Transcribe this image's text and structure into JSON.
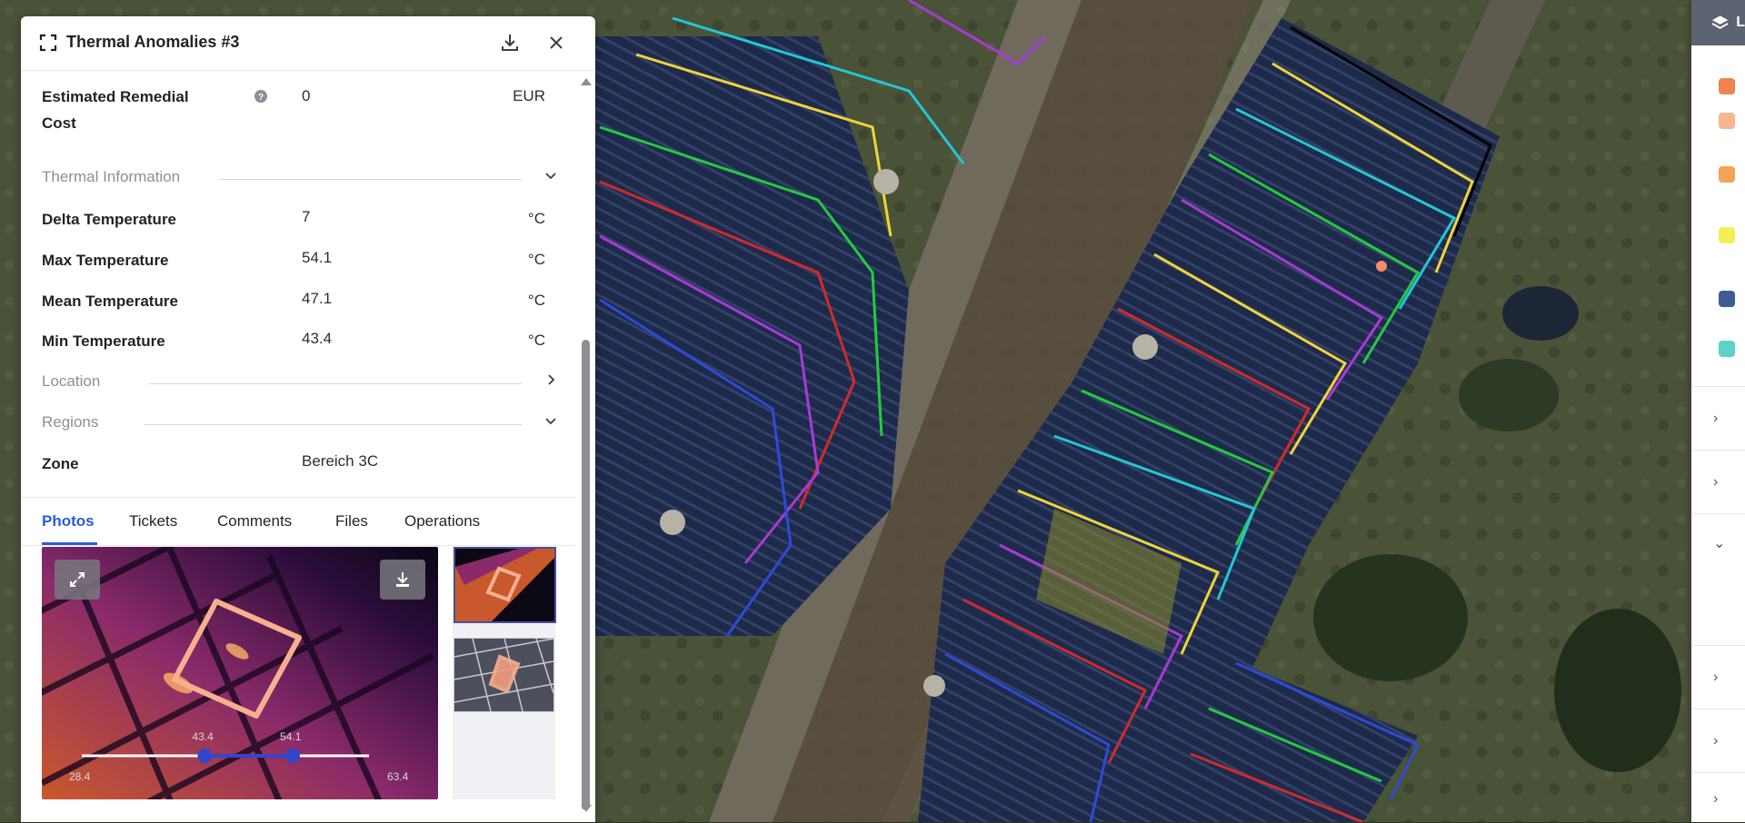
{
  "panel": {
    "title": "Thermal Anomalies #3",
    "fields": {
      "remedial_cost_label": "Estimated Remedial",
      "remedial_cost_label_2": "Cost",
      "remedial_cost_value": "0",
      "remedial_cost_unit": "EUR"
    },
    "sections": {
      "thermal": "Thermal Information",
      "location": "Location",
      "regions": "Regions"
    },
    "thermal_rows": [
      {
        "label": "Delta Temperature",
        "value": "7",
        "unit": "°C"
      },
      {
        "label": "Max Temperature",
        "value": "54.1",
        "unit": "°C"
      },
      {
        "label": "Mean Temperature",
        "value": "47.1",
        "unit": "°C"
      },
      {
        "label": "Min Temperature",
        "value": "43.4",
        "unit": "°C"
      }
    ],
    "zone": {
      "label": "Zone",
      "value": "Bereich 3C"
    },
    "tabs": [
      "Photos",
      "Tickets",
      "Comments",
      "Files",
      "Operations"
    ],
    "active_tab": "Photos",
    "photo_slider": {
      "min": "28.4",
      "max": "63.4",
      "low": "43.4",
      "high": "54.1",
      "low_value": 43.4,
      "high_value": 54.1,
      "range_min": 28.4,
      "range_max": 63.4
    }
  },
  "layers_panel": {
    "header_label": "L",
    "swatch_colors": [
      "#f0834f",
      "#f7b591",
      "#f2a455",
      "#f3ee55",
      "#3f5b97",
      "#5cd2cc"
    ]
  },
  "colors": {
    "accent": "#2a5bd7",
    "panel_bg": "#ffffff"
  }
}
